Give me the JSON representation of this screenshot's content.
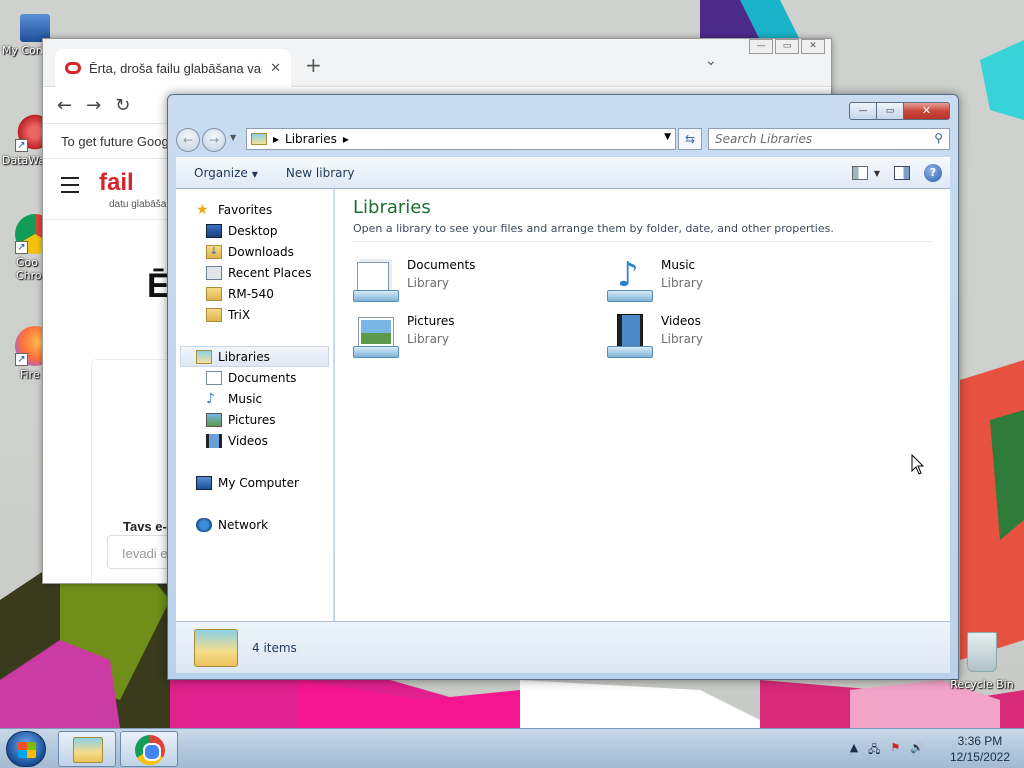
{
  "desktop": {
    "icons": [
      {
        "label": "My Com"
      },
      {
        "label": "DataWa"
      },
      {
        "label": "Goo"
      },
      {
        "label": "Chro"
      },
      {
        "label": "Fire"
      }
    ],
    "recycle_bin": {
      "label": "Recycle Bin"
    }
  },
  "chrome": {
    "tab_title": "Ērta, droša failu glabāšana vai ap",
    "new_tab": "+",
    "infobar_text": "To get future Goog",
    "logo": "fail",
    "logo_sub": "datu glabāša",
    "headline_fragment": "Ē",
    "email_label": "Tavs e-",
    "email_placeholder": "Ievadi e"
  },
  "explorer": {
    "title_buttons": {
      "minimize": "—",
      "maximize": "▭",
      "close": "✕"
    },
    "address": {
      "root_arrow": "▸",
      "crumb": "Libraries",
      "crumb_arrow": "▸"
    },
    "search_placeholder": "Search Libraries",
    "commands": {
      "organize": "Organize",
      "new_library": "New library"
    },
    "nav": {
      "favorites": {
        "label": "Favorites",
        "items": [
          "Desktop",
          "Downloads",
          "Recent Places",
          "RM-540",
          "TriX"
        ]
      },
      "libraries": {
        "label": "Libraries",
        "items": [
          "Documents",
          "Music",
          "Pictures",
          "Videos"
        ]
      },
      "computer": {
        "label": "My Computer"
      },
      "network": {
        "label": "Network"
      }
    },
    "content": {
      "heading": "Libraries",
      "description": "Open a library to see your files and arrange them by folder, date, and other properties.",
      "libraries": [
        {
          "name": "Documents",
          "type": "Library",
          "icon": "documents-library-icon"
        },
        {
          "name": "Music",
          "type": "Library",
          "icon": "music-library-icon"
        },
        {
          "name": "Pictures",
          "type": "Library",
          "icon": "pictures-library-icon"
        },
        {
          "name": "Videos",
          "type": "Library",
          "icon": "videos-library-icon"
        }
      ]
    },
    "status": {
      "item_count": "4 items"
    }
  },
  "taskbar": {
    "clock": {
      "time": "3:36 PM",
      "date": "12/15/2022"
    }
  },
  "colors": {
    "accent_heading": "#1e6e2e",
    "close_button": "#c7463a"
  }
}
